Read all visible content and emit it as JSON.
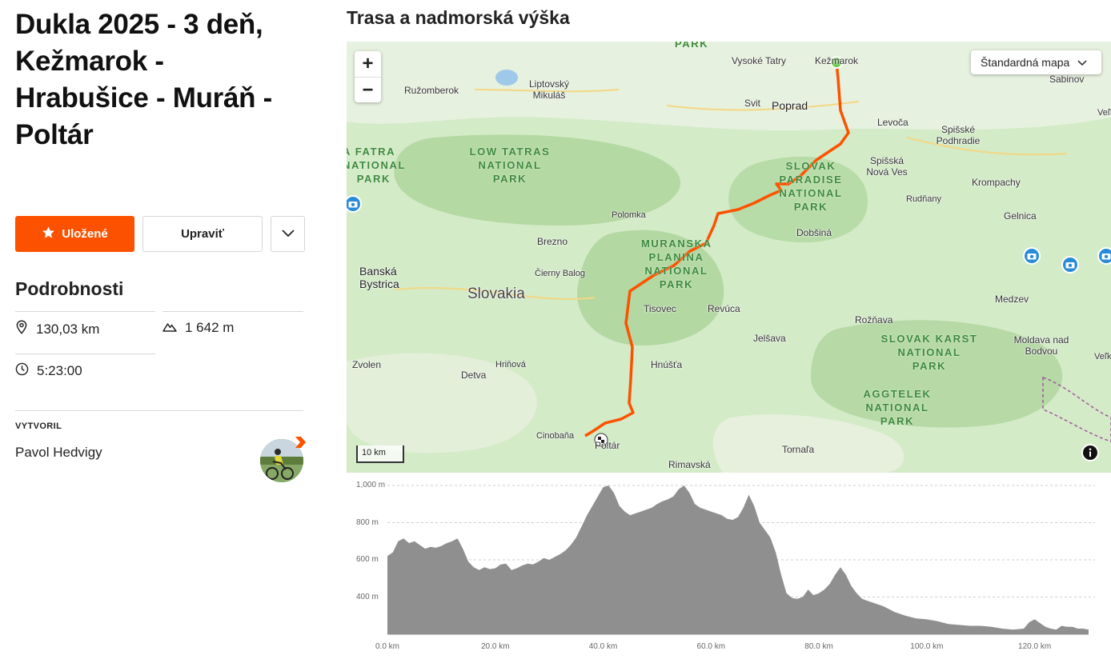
{
  "route": {
    "title": "Dukla 2025 - 3 deň, Kežmarok - Hrabušice - Muráň - Poltár"
  },
  "actions": {
    "saved_label": "Uložené",
    "edit_label": "Upraviť"
  },
  "details": {
    "heading": "Podrobnosti",
    "distance": "130,03 km",
    "elevation_gain": "1 642 m",
    "time": "5:23:00"
  },
  "creator": {
    "label": "VYTVORIL",
    "name": "Pavol Hedvigy"
  },
  "map": {
    "heading": "Trasa a nadmorská výška",
    "map_type": "Štandardná mapa",
    "scale": "10 km",
    "labels": [
      {
        "name": "Vysoké Tatry"
      },
      {
        "name": "Kežmarok"
      },
      {
        "name": "Sabinov"
      },
      {
        "name": "Ružomberok"
      },
      {
        "name": "Liptovský Mikuláš"
      },
      {
        "name": "Svit"
      },
      {
        "name": "Poprad"
      },
      {
        "name": "Levoča"
      },
      {
        "name": "Spišské Podhradie"
      },
      {
        "name": "Spišská Nová Ves"
      },
      {
        "name": "Krompachy"
      },
      {
        "name": "Rudňany"
      },
      {
        "name": "Gelnica"
      },
      {
        "name": "Polomka"
      },
      {
        "name": "Brezno"
      },
      {
        "name": "Dobšiná"
      },
      {
        "name": "Banská Bystrica"
      },
      {
        "name": "Čierny Balog"
      },
      {
        "name": "Slovakia"
      },
      {
        "name": "Tisovec"
      },
      {
        "name": "Revúca"
      },
      {
        "name": "Rožňava"
      },
      {
        "name": "Medzev"
      },
      {
        "name": "Jelšava"
      },
      {
        "name": "Moldava nad Bodvou"
      },
      {
        "name": "Zvolen"
      },
      {
        "name": "Detva"
      },
      {
        "name": "Hriňová"
      },
      {
        "name": "Hnúšťa"
      },
      {
        "name": "Cinobaňa"
      },
      {
        "name": "Poltár"
      },
      {
        "name": "Tornaľa"
      },
      {
        "name": "Rimavská"
      },
      {
        "name": "Veľký"
      },
      {
        "name": "Veľká I"
      }
    ],
    "parks": [
      "LOW TATRAS NATIONAL PARK",
      "SLOVAK PARADISE NATIONAL PARK",
      "MURANSKA PLANINA NATIONAL PARK",
      "SLOVAK KARST NATIONAL PARK",
      "AGGTELEK NATIONAL PARK",
      "A FATRA NATIONAL PARK",
      "PARK"
    ],
    "route_color": "#fc5200"
  },
  "chart_data": {
    "type": "area",
    "xlabel": "",
    "ylabel": "",
    "xlim": [
      0,
      130
    ],
    "ylim": [
      200,
      1000
    ],
    "x_ticks": [
      "0.0 km",
      "20.0 km",
      "40.0 km",
      "60.0 km",
      "80.0 km",
      "100.0 km",
      "120.0 km"
    ],
    "y_ticks": [
      "1,000 m",
      "800 m",
      "600 m",
      "400 m"
    ],
    "grid": true,
    "series": [
      {
        "x": [
          0,
          1,
          2,
          3,
          4,
          5,
          6,
          7,
          8,
          9,
          10,
          11,
          12,
          13,
          14,
          15,
          16,
          17,
          18,
          19,
          20,
          21,
          22,
          23,
          24,
          25,
          26,
          27,
          28,
          29,
          30,
          31,
          32,
          33,
          34,
          35,
          36,
          37,
          38,
          39,
          40,
          41,
          42,
          43,
          44,
          45,
          46,
          47,
          48,
          49,
          50,
          51,
          52,
          53,
          54,
          55,
          56,
          57,
          58,
          59,
          60,
          61,
          62,
          63,
          64,
          65,
          66,
          67,
          68,
          69,
          70,
          71,
          72,
          73,
          74,
          75,
          76,
          77,
          78,
          79,
          80,
          81,
          82,
          83,
          84,
          85,
          86,
          87,
          88,
          89,
          90,
          92,
          94,
          96,
          98,
          100,
          102,
          104,
          106,
          108,
          110,
          112,
          114,
          116,
          118,
          119,
          120,
          121,
          122,
          123,
          124,
          125,
          126,
          127,
          128,
          129,
          130
        ],
        "values": [
          620,
          640,
          700,
          715,
          690,
          700,
          680,
          660,
          670,
          665,
          675,
          690,
          700,
          715,
          660,
          590,
          560,
          545,
          560,
          550,
          555,
          575,
          580,
          545,
          555,
          570,
          580,
          575,
          590,
          610,
          600,
          615,
          630,
          650,
          680,
          720,
          780,
          840,
          890,
          940,
          990,
          1000,
          960,
          890,
          860,
          840,
          850,
          860,
          870,
          880,
          900,
          915,
          925,
          940,
          980,
          1000,
          960,
          900,
          880,
          870,
          860,
          850,
          840,
          820,
          815,
          830,
          880,
          950,
          890,
          800,
          760,
          720,
          640,
          520,
          420,
          395,
          390,
          400,
          440,
          410,
          420,
          440,
          470,
          520,
          560,
          520,
          460,
          420,
          390,
          380,
          370,
          350,
          320,
          300,
          285,
          280,
          270,
          255,
          250,
          245,
          245,
          240,
          230,
          225,
          230,
          265,
          280,
          260,
          240,
          230,
          225,
          245,
          240,
          240,
          230,
          230,
          225
        ]
      }
    ]
  }
}
